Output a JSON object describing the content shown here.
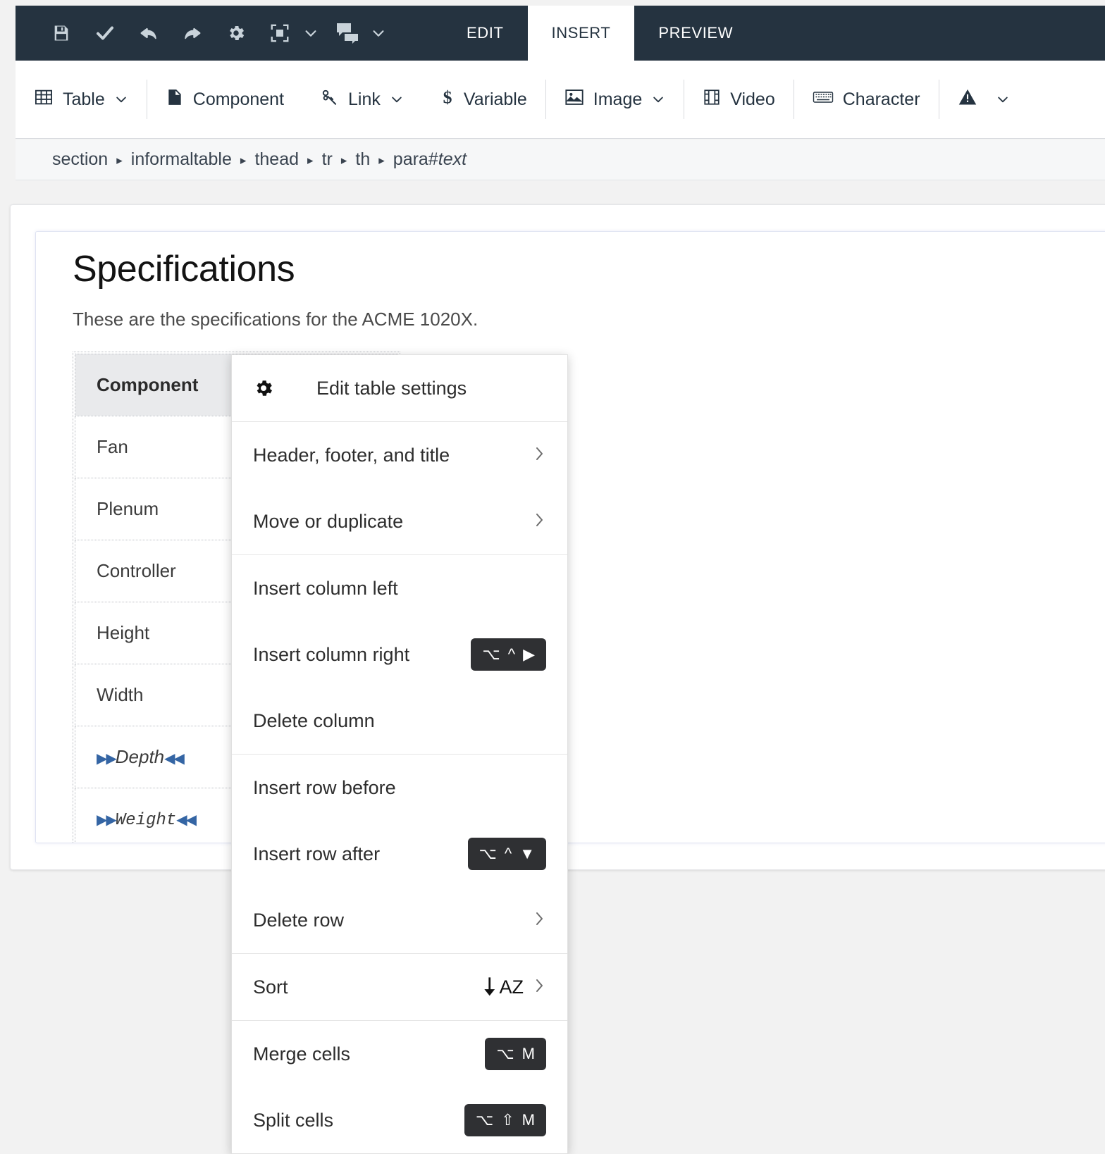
{
  "topbar": {
    "icons": [
      {
        "name": "save-icon",
        "title": "Save"
      },
      {
        "name": "check-icon",
        "title": "Check"
      },
      {
        "name": "undo-icon",
        "title": "Undo"
      },
      {
        "name": "redo-icon",
        "title": "Redo"
      },
      {
        "name": "gear-icon",
        "title": "Settings"
      },
      {
        "name": "fullscreen-icon",
        "title": "Fullscreen"
      },
      {
        "name": "comment-icon",
        "title": "Comments"
      }
    ],
    "tabs": [
      {
        "label": "EDIT",
        "active": false
      },
      {
        "label": "INSERT",
        "active": true
      },
      {
        "label": "PREVIEW",
        "active": false
      }
    ]
  },
  "toolbar": {
    "items": [
      {
        "label": "Table",
        "icon": "table-icon",
        "caret": true
      },
      {
        "label": "Component",
        "icon": "component-icon",
        "caret": false
      },
      {
        "label": "Link",
        "icon": "link-icon",
        "caret": true
      },
      {
        "label": "Variable",
        "icon": "variable-icon",
        "caret": false
      },
      {
        "label": "Image",
        "icon": "image-icon",
        "caret": true
      },
      {
        "label": "Video",
        "icon": "video-icon",
        "caret": false
      },
      {
        "label": "Character",
        "icon": "character-icon",
        "caret": false
      },
      {
        "label": "",
        "icon": "warning-icon",
        "caret": true
      }
    ]
  },
  "breadcrumb": {
    "separator": "▸",
    "items": [
      "section",
      "informaltable",
      "thead",
      "tr",
      "th"
    ],
    "last_prefix": "para#",
    "last_italic": "text"
  },
  "document": {
    "title": "Specifications",
    "paragraph": "These are the specifications for the ACME 1020X.",
    "table": {
      "header": [
        "Component",
        ""
      ],
      "rows": [
        {
          "label": "Fan",
          "style": "normal"
        },
        {
          "label": "Plenum",
          "style": "normal"
        },
        {
          "label": "Controller",
          "style": "normal"
        },
        {
          "label": "Height",
          "style": "normal"
        },
        {
          "label": "Width",
          "style": "normal"
        },
        {
          "label": "Depth",
          "style": "italic-marked"
        },
        {
          "label": "Weight",
          "style": "mono-marked"
        }
      ],
      "marker_left": "▶▶",
      "marker_right": "◀◀"
    }
  },
  "context_menu": {
    "groups": [
      {
        "items": [
          {
            "label": "Edit table settings",
            "icon": "gear-icon",
            "chevron": false,
            "shortcut": null
          }
        ]
      },
      {
        "items": [
          {
            "label": "Header, footer, and title",
            "icon": null,
            "chevron": true,
            "shortcut": null
          },
          {
            "label": "Move or duplicate",
            "icon": null,
            "chevron": true,
            "shortcut": null
          }
        ]
      },
      {
        "items": [
          {
            "label": "Insert column left",
            "icon": null,
            "chevron": false,
            "shortcut": null
          },
          {
            "label": "Insert column right",
            "icon": null,
            "chevron": false,
            "shortcut": [
              "option",
              "control",
              "arrow-right"
            ]
          },
          {
            "label": "Delete column",
            "icon": null,
            "chevron": false,
            "shortcut": null
          }
        ]
      },
      {
        "items": [
          {
            "label": "Insert row before",
            "icon": null,
            "chevron": false,
            "shortcut": null
          },
          {
            "label": "Insert row after",
            "icon": null,
            "chevron": false,
            "shortcut": [
              "option",
              "control",
              "arrow-down"
            ]
          },
          {
            "label": "Delete row",
            "icon": null,
            "chevron": true,
            "shortcut": null
          }
        ]
      },
      {
        "items": [
          {
            "label": "Sort",
            "icon": null,
            "chevron": true,
            "shortcut": null,
            "trailing_icon": "sort-az-icon"
          }
        ]
      },
      {
        "items": [
          {
            "label": "Merge cells",
            "icon": null,
            "chevron": false,
            "shortcut": [
              "option",
              "M"
            ]
          },
          {
            "label": "Split cells",
            "icon": null,
            "chevron": false,
            "shortcut": [
              "option",
              "shift",
              "M"
            ]
          }
        ]
      }
    ],
    "keys": {
      "option": "⌥",
      "control": "^",
      "shift": "⇧",
      "arrow-right": "▶",
      "arrow-down": "▼",
      "M": "M"
    }
  },
  "colors": {
    "topbar_bg": "#253340",
    "accent_marker": "#3465a4",
    "kbd_bg": "#2f3033",
    "header_cell_bg": "#e9eaec"
  }
}
